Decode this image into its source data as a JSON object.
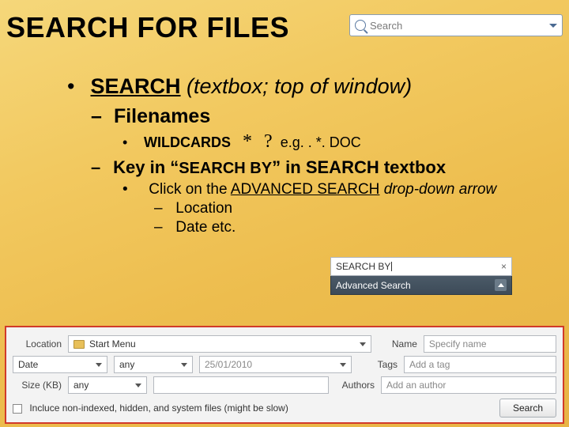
{
  "title": "SEARCH FOR FILES",
  "top_search": {
    "placeholder": "Search"
  },
  "l1": {
    "bullet": "•",
    "text_bold": "SEARCH",
    "text_rest": " (textbox; top of window)"
  },
  "l2a": {
    "dash": "–",
    "text": "Filenames"
  },
  "l3a": {
    "dot": "•",
    "label": "WILDCARDS",
    "star": "*",
    "q": "?",
    "eg": "e.g. . *. DOC"
  },
  "l2b": {
    "dash": "–",
    "pre": "Key in ",
    "quote1": "“",
    "by": "SEARCH BY",
    "quote2": "”",
    "post": " in SEARCH textbox"
  },
  "l4": {
    "dot": "•",
    "pre": "Click on the ",
    "u": "ADVANCED SEARCH",
    "post": " drop-down arrow"
  },
  "l5a": {
    "dash": "–",
    "text": "Location"
  },
  "l5b": {
    "dash": "–",
    "text": "Date etc."
  },
  "adv": {
    "search_text": "SEARCH BY",
    "close": "×",
    "label": "Advanced Search"
  },
  "panel": {
    "location_label": "Location",
    "location_value": "Start Menu",
    "name_label": "Name",
    "name_placeholder": "Specify name",
    "date_label": "Date",
    "date_any": "any",
    "date_value": "25/01/2010",
    "tags_label": "Tags",
    "tags_placeholder": "Add a tag",
    "size_label": "Size (KB)",
    "size_any": "any",
    "authors_label": "Authors",
    "authors_placeholder": "Add an author",
    "include_label": "Incluce non-indexed, hidden, and system files (might be slow)",
    "search_button": "Search"
  }
}
